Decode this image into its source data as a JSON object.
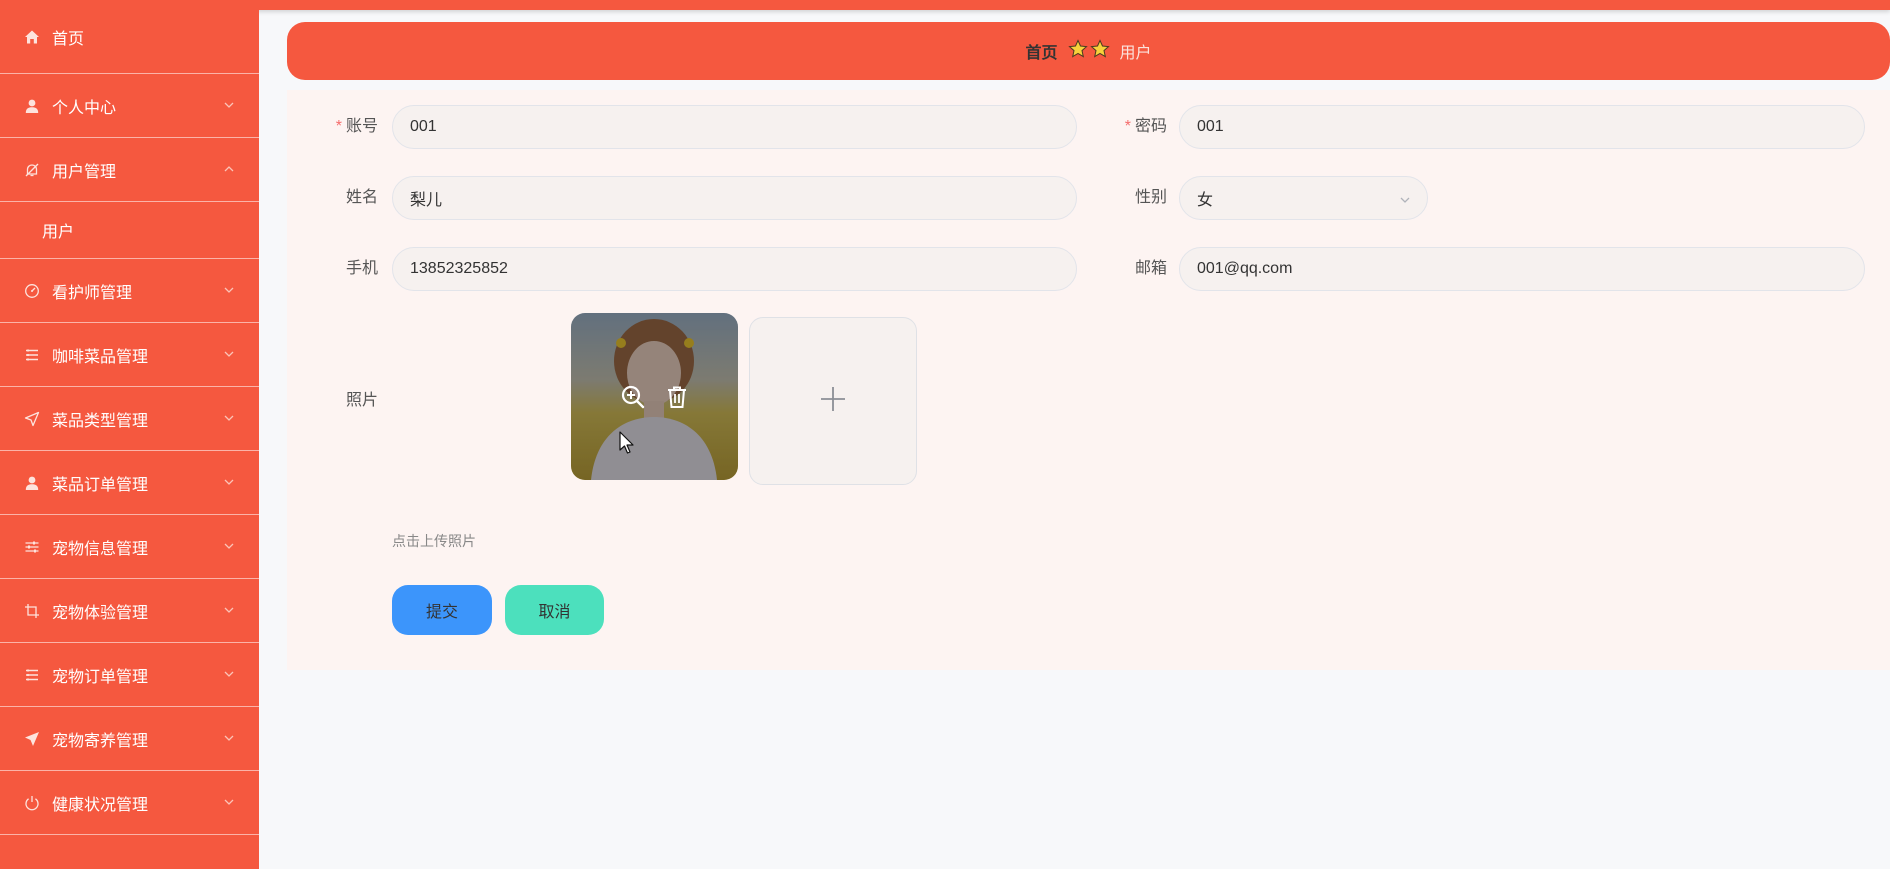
{
  "sidebar": {
    "home": {
      "label": "首页",
      "icon": "home-icon"
    },
    "items": [
      {
        "label": "个人中心",
        "icon": "user-icon",
        "expanded": false
      },
      {
        "label": "用户管理",
        "icon": "bell-off-icon",
        "expanded": true,
        "children": [
          {
            "label": "用户"
          }
        ]
      },
      {
        "label": "看护师管理",
        "icon": "gauge-icon",
        "expanded": false
      },
      {
        "label": "咖啡菜品管理",
        "icon": "list-icon",
        "expanded": false
      },
      {
        "label": "菜品类型管理",
        "icon": "send-icon",
        "expanded": false
      },
      {
        "label": "菜品订单管理",
        "icon": "user-icon",
        "expanded": false
      },
      {
        "label": "宠物信息管理",
        "icon": "sliders-icon",
        "expanded": false
      },
      {
        "label": "宠物体验管理",
        "icon": "crop-icon",
        "expanded": false
      },
      {
        "label": "宠物订单管理",
        "icon": "list-icon",
        "expanded": false
      },
      {
        "label": "宠物寄养管理",
        "icon": "send-filled-icon",
        "expanded": false
      },
      {
        "label": "健康状况管理",
        "icon": "power-icon",
        "expanded": false
      }
    ]
  },
  "breadcrumb": {
    "home": "首页",
    "current": "用户"
  },
  "form": {
    "account": {
      "label": "账号",
      "value": "001",
      "required": true
    },
    "password": {
      "label": "密码",
      "value": "001",
      "required": true
    },
    "name": {
      "label": "姓名",
      "value": "梨儿"
    },
    "gender": {
      "label": "性别",
      "value": "女"
    },
    "phone": {
      "label": "手机",
      "value": "13852325852"
    },
    "email": {
      "label": "邮箱",
      "value": "001@qq.com"
    },
    "photo": {
      "label": "照片",
      "tip": "点击上传照片"
    },
    "submit_label": "提交",
    "cancel_label": "取消"
  },
  "colors": {
    "brand": "#f5583f",
    "submit": "#3c95fb",
    "cancel": "#4ce0bd",
    "required": "#f56c6c"
  }
}
